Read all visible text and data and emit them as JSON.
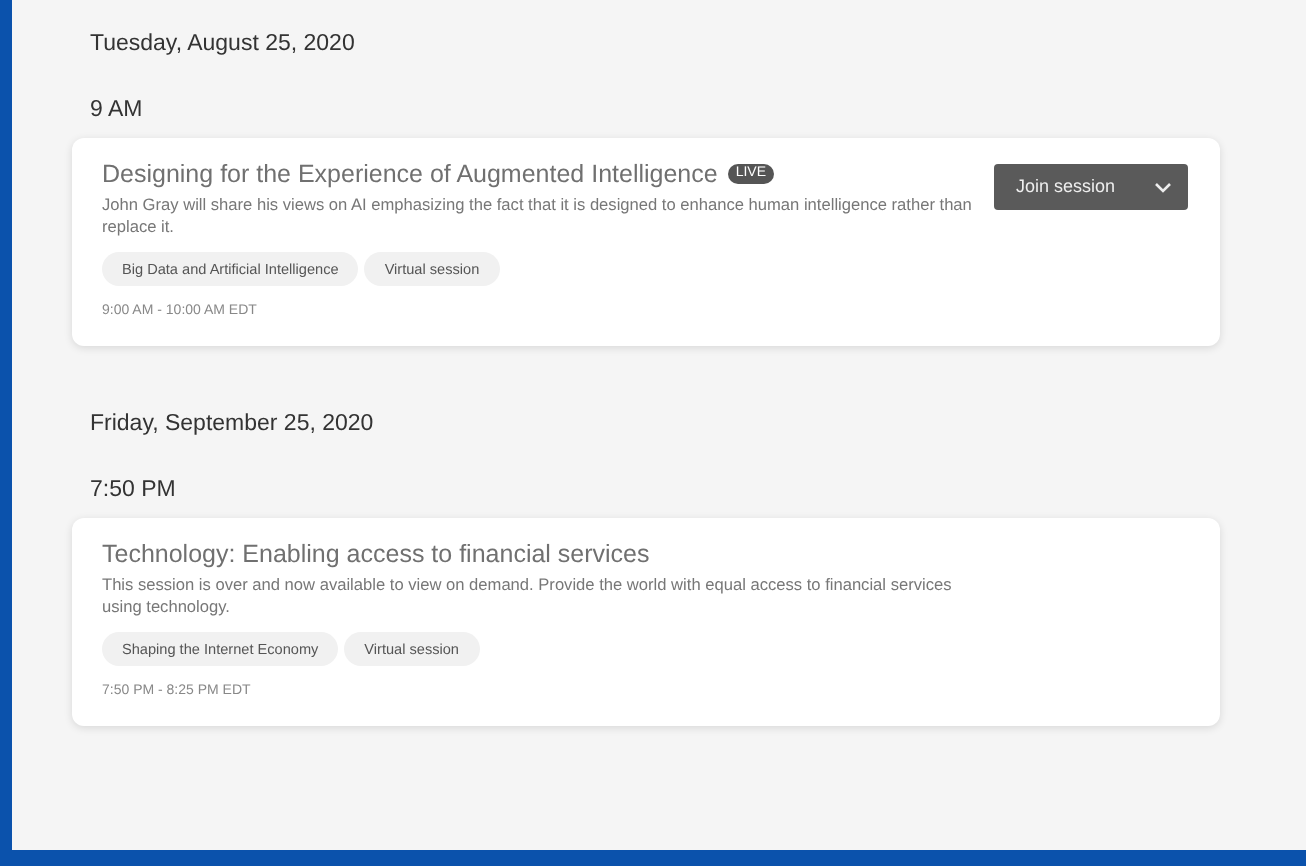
{
  "days": [
    {
      "date": "Tuesday, August 25, 2020",
      "slots": [
        {
          "time": "9 AM",
          "sessions": [
            {
              "title": "Designing for the Experience of Augmented Intelligence",
              "badge": "LIVE",
              "description": "John Gray will share his views on AI emphasizing the fact that it is designed to enhance human intelligence rather than replace it.",
              "tags": [
                "Big Data and Artificial Intelligence",
                "Virtual session"
              ],
              "time_range": "9:00 AM - 10:00 AM EDT",
              "action": "Join session"
            }
          ]
        }
      ]
    },
    {
      "date": "Friday, September 25, 2020",
      "slots": [
        {
          "time": "7:50 PM",
          "sessions": [
            {
              "title": "Technology: Enabling access to financial services",
              "description": "This session is over and now available to view on demand. Provide the world with equal access to financial services using technology.",
              "tags": [
                "Shaping the Internet Economy",
                "Virtual session"
              ],
              "time_range": "7:50 PM - 8:25 PM EDT"
            }
          ]
        }
      ]
    }
  ]
}
